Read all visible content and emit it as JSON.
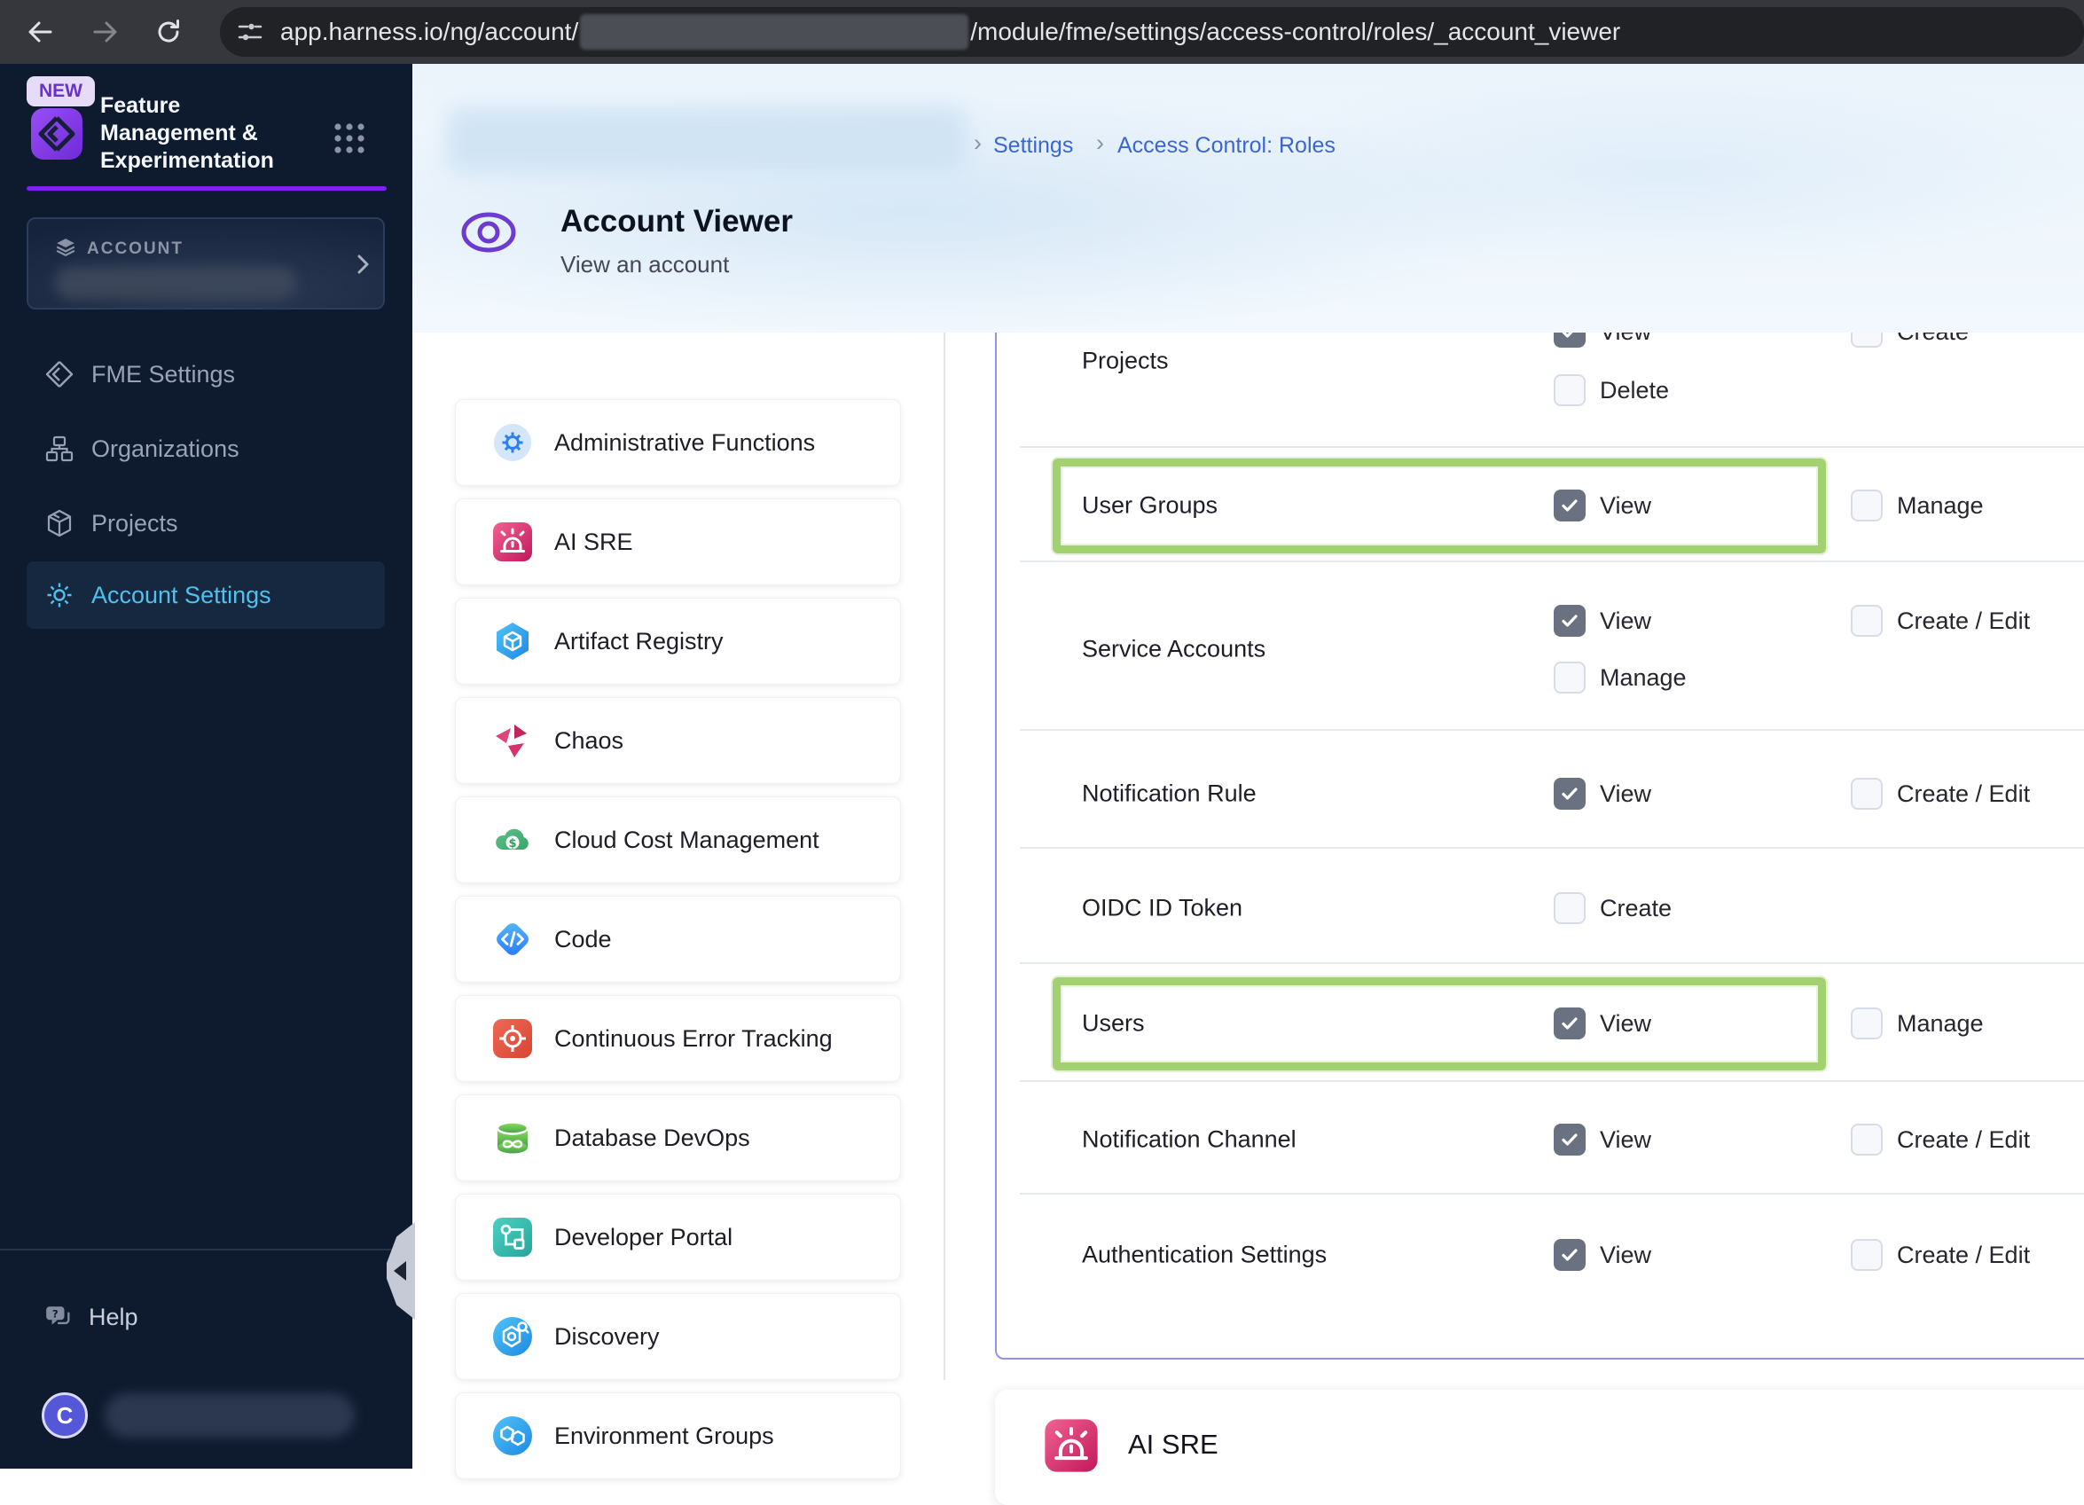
{
  "browser": {
    "url_prefix": "app.harness.io/ng/account/",
    "url_suffix": "/module/fme/settings/access-control/roles/_account_viewer"
  },
  "sidebar": {
    "new_badge": "NEW",
    "product_name": "Feature Management & Experimentation",
    "account_section": {
      "label": "ACCOUNT"
    },
    "nav_items": [
      {
        "label": "FME Settings",
        "icon": "fme-logo-icon",
        "active": false
      },
      {
        "label": "Organizations",
        "icon": "organizations-icon",
        "active": false
      },
      {
        "label": "Projects",
        "icon": "projects-cube-icon",
        "active": false
      },
      {
        "label": "Account Settings",
        "icon": "gear-icon",
        "active": true
      }
    ],
    "help_label": "Help",
    "avatar_letter": "C"
  },
  "header": {
    "breadcrumb_settings": "Settings",
    "breadcrumb_roles": "Access Control: Roles",
    "title": "Account Viewer",
    "subtitle": "View an account"
  },
  "modules": [
    {
      "label": "Administrative Functions",
      "icon": "admin-gear-icon"
    },
    {
      "label": "AI SRE",
      "icon": "siren-icon"
    },
    {
      "label": "Artifact Registry",
      "icon": "artifact-hexagon-icon"
    },
    {
      "label": "Chaos",
      "icon": "chaos-pinwheel-icon"
    },
    {
      "label": "Cloud Cost Management",
      "icon": "cloud-dollar-icon"
    },
    {
      "label": "Code",
      "icon": "code-diamond-icon"
    },
    {
      "label": "Continuous Error Tracking",
      "icon": "target-icon"
    },
    {
      "label": "Database DevOps",
      "icon": "database-icon"
    },
    {
      "label": "Developer Portal",
      "icon": "flowchart-icon"
    },
    {
      "label": "Discovery",
      "icon": "discovery-radar-icon"
    },
    {
      "label": "Environment Groups",
      "icon": "hexagon-cluster-icon"
    }
  ],
  "permissions": {
    "rows": [
      {
        "label": "Projects",
        "highlighted": false,
        "cells": [
          {
            "label": "View",
            "checked": true
          },
          {
            "label": "Create",
            "checked": false
          },
          {
            "label": "Delete",
            "checked": false
          }
        ]
      },
      {
        "label": "User Groups",
        "highlighted": true,
        "cells": [
          {
            "label": "View",
            "checked": true
          },
          {
            "label": "Manage",
            "checked": false
          }
        ]
      },
      {
        "label": "Service Accounts",
        "highlighted": false,
        "cells": [
          {
            "label": "View",
            "checked": true
          },
          {
            "label": "Create / Edit",
            "checked": false
          },
          {
            "label": "Manage",
            "checked": false
          }
        ]
      },
      {
        "label": "Notification Rule",
        "highlighted": false,
        "cells": [
          {
            "label": "View",
            "checked": true
          },
          {
            "label": "Create / Edit",
            "checked": false
          }
        ]
      },
      {
        "label": "OIDC ID Token",
        "highlighted": false,
        "cells": [
          {
            "label": "Create",
            "checked": false
          }
        ]
      },
      {
        "label": "Users",
        "highlighted": true,
        "cells": [
          {
            "label": "View",
            "checked": true
          },
          {
            "label": "Manage",
            "checked": false
          }
        ]
      },
      {
        "label": "Notification Channel",
        "highlighted": false,
        "cells": [
          {
            "label": "View",
            "checked": true
          },
          {
            "label": "Create / Edit",
            "checked": false
          }
        ]
      },
      {
        "label": "Authentication Settings",
        "highlighted": false,
        "cells": [
          {
            "label": "View",
            "checked": true
          },
          {
            "label": "Create / Edit",
            "checked": false
          }
        ]
      }
    ]
  },
  "next_section": {
    "label": "AI SRE",
    "icon": "siren-icon"
  },
  "colors": {
    "accent_purple": "#7b20f2",
    "active_blue": "#4fc0f0",
    "link_blue": "#3a66d1",
    "marker_green": "#a3d171",
    "panel_border": "#8d96ea",
    "checkbox_checked": "#6a7180"
  }
}
